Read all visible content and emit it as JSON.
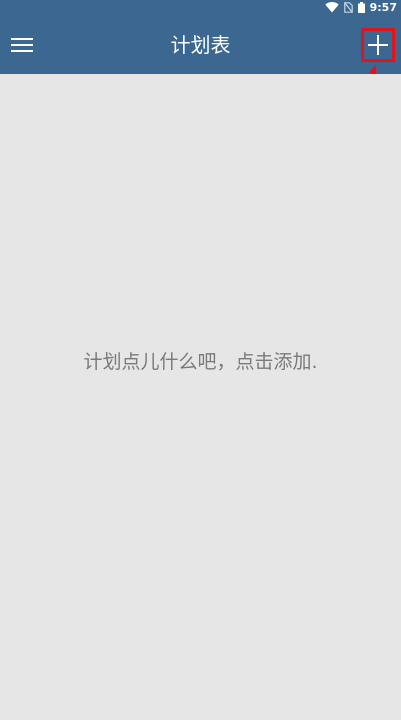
{
  "status_bar": {
    "time": "9:57",
    "icons": [
      "wifi-icon",
      "no-sim-icon",
      "battery-icon"
    ]
  },
  "app_bar": {
    "title": "计划表",
    "menu_icon": "hamburger-menu-icon",
    "add_icon": "plus-icon"
  },
  "annotation": {
    "highlight_color": "#e3131b",
    "target": "add-button"
  },
  "main": {
    "empty_hint": "计划点儿什么吧，点击添加."
  },
  "colors": {
    "primary": "#3b6791",
    "background": "#e6e6e6",
    "hint_text": "#7a7a7a",
    "annotation": "#e3131b"
  }
}
